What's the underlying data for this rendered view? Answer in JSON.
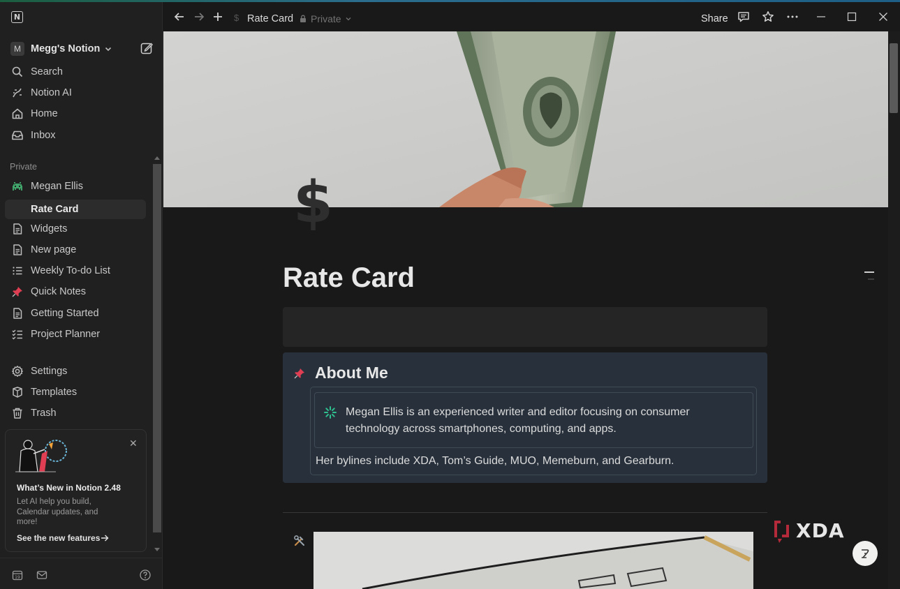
{
  "app": {
    "workspace_initial": "M",
    "workspace_name": "Megg's Notion"
  },
  "sidebar": {
    "top_items": [
      {
        "label": "Search",
        "icon": "search-icon"
      },
      {
        "label": "Notion AI",
        "icon": "notion-ai-icon"
      },
      {
        "label": "Home",
        "icon": "home-icon"
      },
      {
        "label": "Inbox",
        "icon": "inbox-icon"
      }
    ],
    "section_label": "Private",
    "pages": [
      {
        "label": "Megan Ellis",
        "icon": "space-invader-icon"
      },
      {
        "label": "Rate Card",
        "icon": "dollar-icon",
        "active": true
      },
      {
        "label": "Widgets",
        "icon": "page-icon"
      },
      {
        "label": "New page",
        "icon": "page-icon"
      },
      {
        "label": "Weekly To-do List",
        "icon": "list-icon"
      },
      {
        "label": "Quick Notes",
        "icon": "pushpin-icon"
      },
      {
        "label": "Getting Started",
        "icon": "page-icon"
      },
      {
        "label": "Project Planner",
        "icon": "checklist-icon"
      }
    ],
    "bottom_items": [
      {
        "label": "Settings",
        "icon": "gear-icon"
      },
      {
        "label": "Templates",
        "icon": "templates-icon"
      },
      {
        "label": "Trash",
        "icon": "trash-icon"
      }
    ],
    "promo": {
      "title": "What’s New in Notion 2.48",
      "body": "Let AI help you build, Calendar updates, and more!",
      "link": "See the new features"
    }
  },
  "topbar": {
    "breadcrumb": "Rate Card",
    "privacy": "Private",
    "share_label": "Share"
  },
  "page": {
    "icon": "$",
    "title": "Rate Card",
    "callout": {
      "heading": "About Me",
      "inner_text": "Megan Ellis is an experienced writer and editor focusing on consumer technology across smartphones, computing, and apps.",
      "bylines": "Her bylines include XDA, Tom’s Guide, MUO, Memeburn, and Gearburn."
    }
  },
  "colors": {
    "background": "#191919",
    "sidebar": "#202020",
    "callout": "#27303b",
    "pin_red": "#e03e52",
    "spark_green": "#2fbf8f"
  }
}
